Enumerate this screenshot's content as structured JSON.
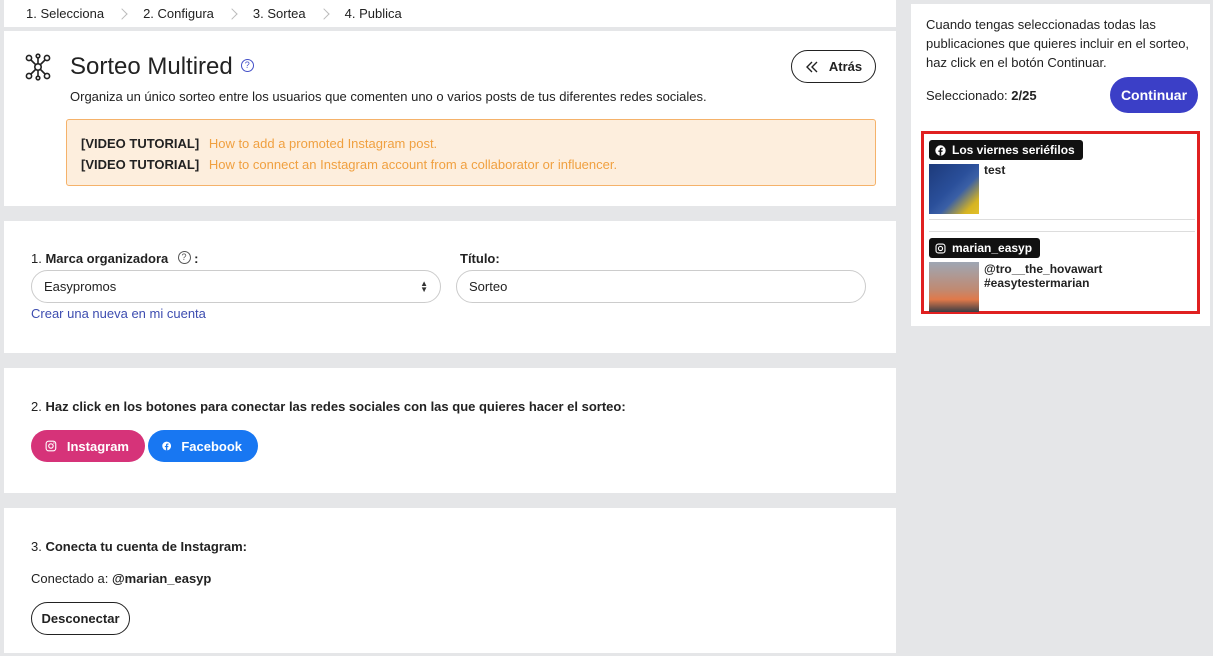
{
  "stepper": {
    "steps": [
      "1. Selecciona",
      "2. Configura",
      "3. Sortea",
      "4. Publica"
    ]
  },
  "header": {
    "title": "Sorteo Multired",
    "help": "?",
    "subtitle": "Organiza un único sorteo entre los usuarios que comenten uno o varios posts de tus diferentes redes sociales.",
    "back_label": "Atrás"
  },
  "tutorials": [
    {
      "prefix": "[VIDEO TUTORIAL]",
      "link": "How to add a promoted Instagram post."
    },
    {
      "prefix": "[VIDEO TUTORIAL]",
      "link": "How to connect an Instagram account from a collaborator or influencer."
    }
  ],
  "brand": {
    "label_num": "1. ",
    "label": "Marca organizadora",
    "help": "?",
    "colon": ":",
    "selected": "Easypromos",
    "create_link": "Crear una nueva en mi cuenta"
  },
  "title_field": {
    "label": "Título:",
    "value": "Sorteo"
  },
  "networks": {
    "label_num": "2. ",
    "label": "Haz click en los botones para conectar las redes sociales con las que quieres hacer el sorteo:",
    "instagram": "Instagram",
    "facebook": "Facebook"
  },
  "connect": {
    "label_num": "3. ",
    "label": "Conecta tu cuenta de Instagram:",
    "connected_prefix": "Conectado a: ",
    "account": "@marian_easyp",
    "disconnect": "Desconectar"
  },
  "panel": {
    "instructions": "Cuando tengas seleccionadas todas las publicaciones que quieres incluir en el sorteo, haz click en el botón Continuar.",
    "selected_label": "Seleccionado: ",
    "selected_count": "2/25",
    "continue_label": "Continuar",
    "posts": [
      {
        "network": "facebook",
        "account": "Los viernes seriéfilos",
        "text": "test"
      },
      {
        "network": "instagram",
        "account": "marian_easyp",
        "text_line1": "@tro__the_hovawart",
        "text_line2": "#easytestermarian"
      }
    ]
  },
  "colors": {
    "accent": "#3b3fc7",
    "instagram": "#d63379",
    "facebook": "#1877f2",
    "notice_bg": "#fdeedd",
    "notice_border": "#f5b26a",
    "highlight": "#e02020"
  }
}
